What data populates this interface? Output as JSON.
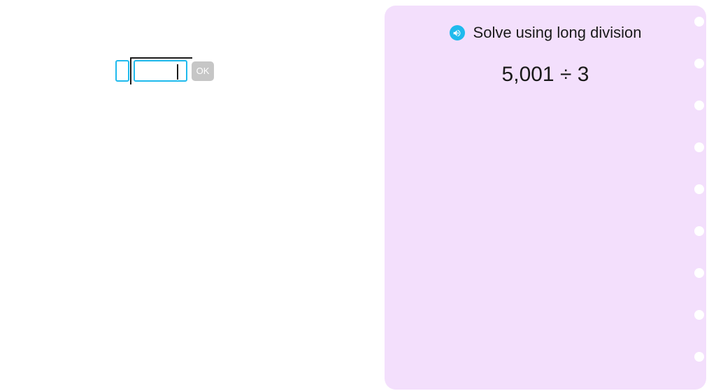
{
  "panel": {
    "instruction": "Solve using long division",
    "problem": "5,001 ÷ 3"
  },
  "workspace": {
    "ok_label": "OK"
  }
}
